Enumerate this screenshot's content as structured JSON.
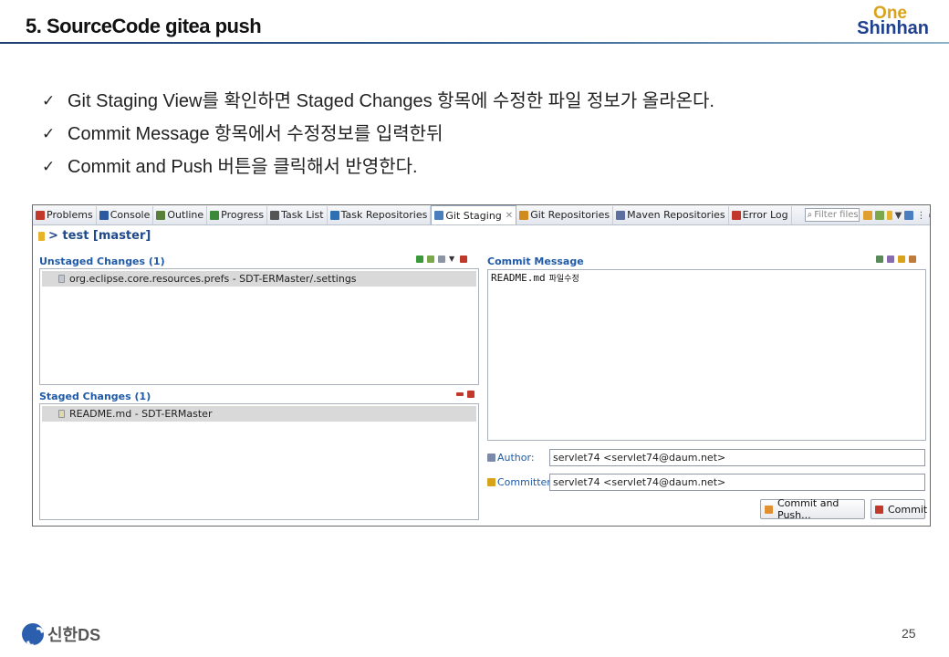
{
  "slide": {
    "title": "5. SourceCode gitea push",
    "logo_top": "One",
    "logo_bottom": "Shinhan",
    "footer_brand": "신한DS",
    "page_number": "25"
  },
  "bullets": [
    {
      "check": "✓",
      "text": "Git Staging View를 확인하면 Staged Changes 항목에 수정한 파일 정보가 올라온다."
    },
    {
      "check": "✓",
      "text": "Commit Message 항목에서 수정정보를 입력한뒤"
    },
    {
      "check": "✓",
      "text": "Commit and Push 버튼을 클릭해서 반영한다."
    }
  ],
  "eclipse": {
    "tabs": [
      {
        "label": "Problems",
        "icon": "problems-icon",
        "color": "#c0392b"
      },
      {
        "label": "Console",
        "icon": "console-icon",
        "color": "#2c5aa0"
      },
      {
        "label": "Outline",
        "icon": "outline-icon",
        "color": "#5a7f3a"
      },
      {
        "label": "Progress",
        "icon": "progress-icon",
        "color": "#3a8a3a"
      },
      {
        "label": "Task List",
        "icon": "task-list-icon",
        "color": "#555555"
      },
      {
        "label": "Task Repositories",
        "icon": "task-repositories-icon",
        "color": "#2c6fb5"
      },
      {
        "label": "Git Staging",
        "icon": "git-staging-icon",
        "color": "#4a7fbf",
        "active": true
      },
      {
        "label": "Git Repositories",
        "icon": "git-repositories-icon",
        "color": "#d08a1e"
      },
      {
        "label": "Maven Repositories",
        "icon": "maven-repositories-icon",
        "color": "#5b6fa0"
      },
      {
        "label": "Error Log",
        "icon": "error-log-icon",
        "color": "#c0392b"
      }
    ],
    "filter_placeholder": "Filter files",
    "repo_title": "> test [master]",
    "unstaged_title": "Unstaged Changes (1)",
    "unstaged_files": [
      "org.eclipse.core.resources.prefs - SDT-ERMaster/.settings"
    ],
    "staged_title": "Staged Changes (1)",
    "staged_files": [
      "README.md - SDT-ERMaster"
    ],
    "commit_title": "Commit Message",
    "commit_text_mono": "README.md",
    "commit_text_kr": "파일수정",
    "author_label": "Author:",
    "author_value": "servlet74 <servlet74@daum.net>",
    "committer_label": "Committer:",
    "committer_value": "servlet74 <servlet74@daum.net>",
    "commit_push_button": "Commit and Push...",
    "commit_button": "Commit"
  },
  "colors": {
    "accent_blue": "#1e5aa8",
    "selected_row": "#d9d9d9",
    "logo_gold": "#d9a21b",
    "logo_navy": "#1f3f8f"
  }
}
